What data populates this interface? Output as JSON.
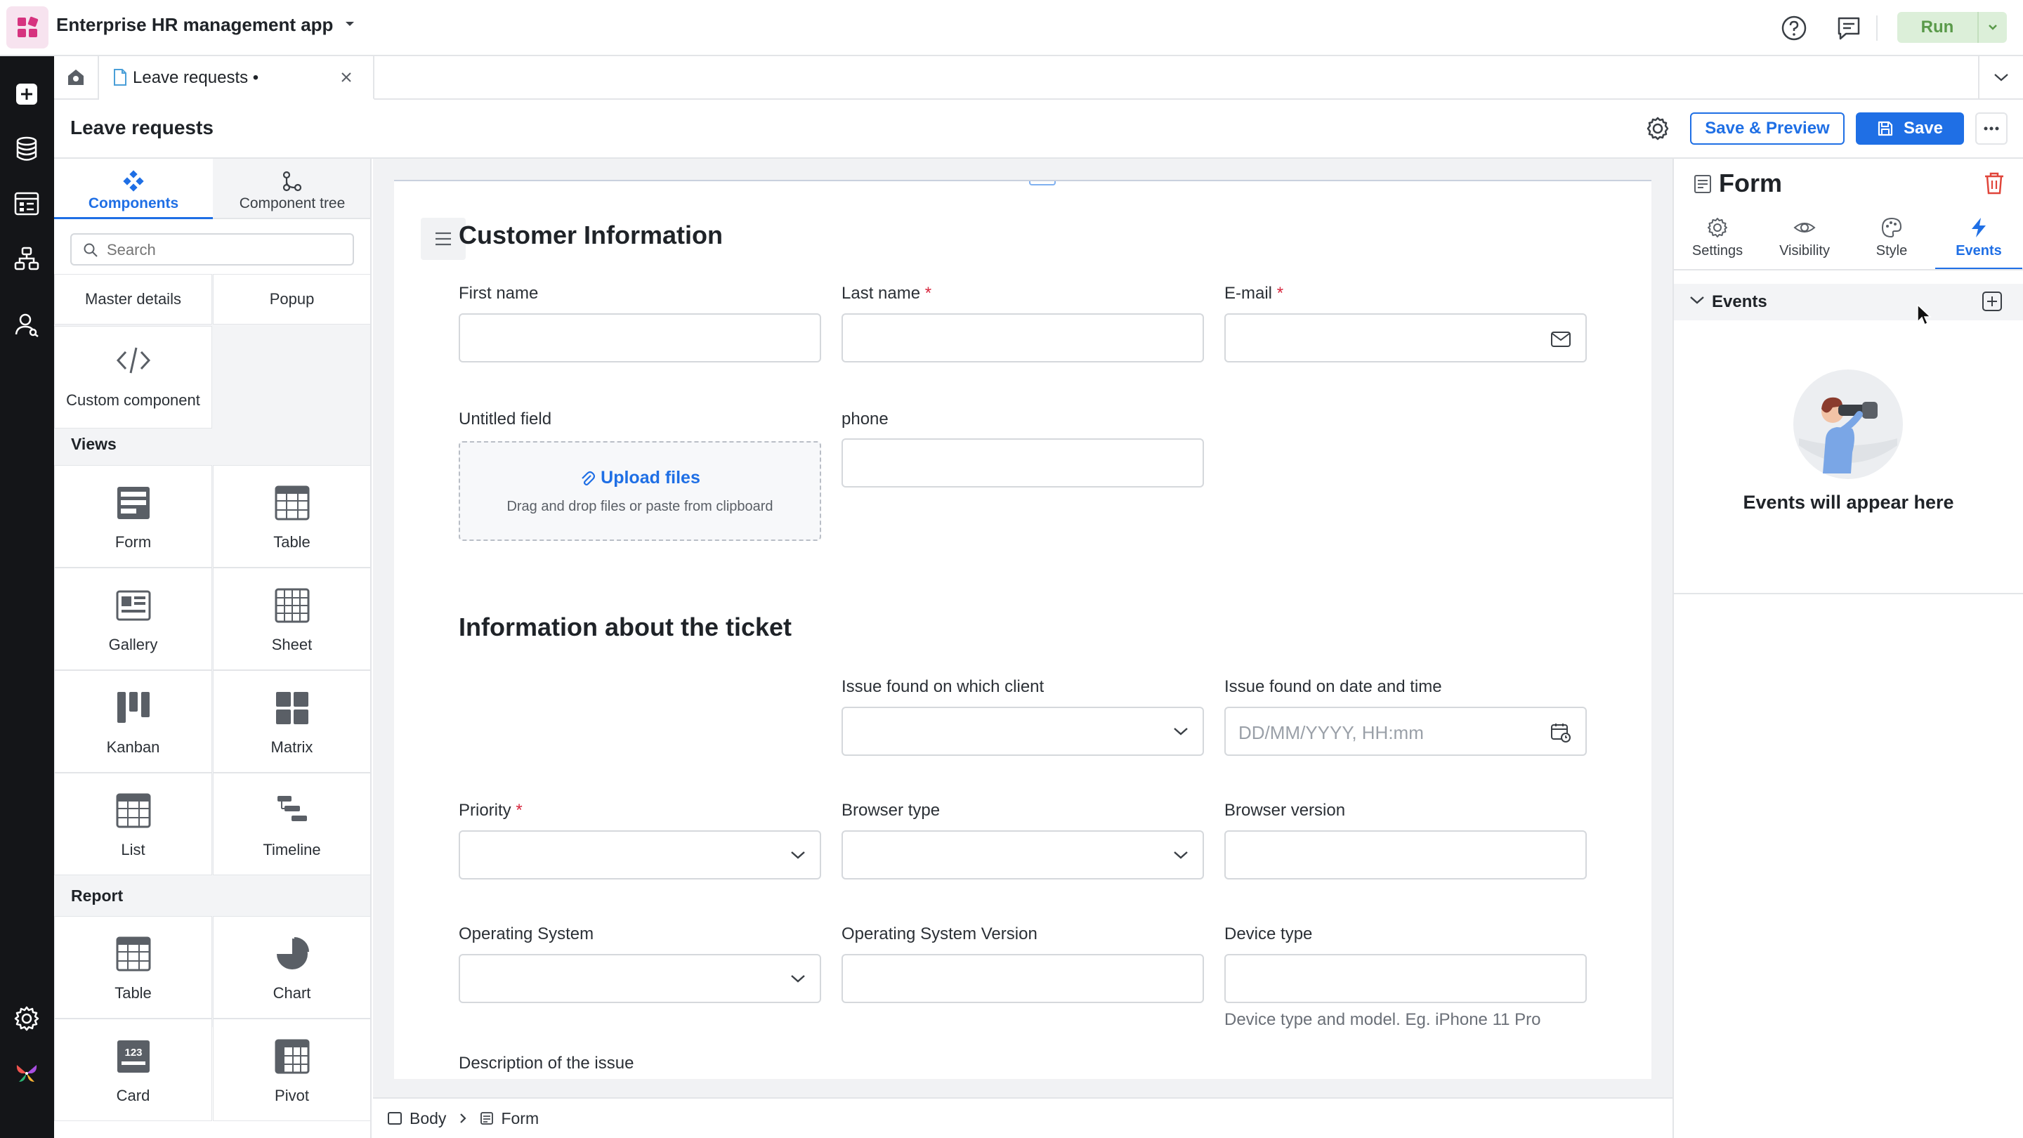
{
  "app": {
    "title": "Enterprise HR management app",
    "run_label": "Run"
  },
  "tabs": {
    "active_tab": "Leave requests •"
  },
  "page": {
    "title": "Leave requests",
    "save_preview_label": "Save & Preview",
    "save_label": "Save"
  },
  "components_panel": {
    "tab_components": "Components",
    "tab_tree": "Component tree",
    "search_placeholder": "Search",
    "top_items": [
      "Master details",
      "Popup"
    ],
    "custom_component": "Custom component",
    "views_title": "Views",
    "views": [
      "Form",
      "Table",
      "Gallery",
      "Sheet",
      "Kanban",
      "Matrix",
      "List",
      "Timeline"
    ],
    "report_title": "Report",
    "report": [
      "Table",
      "Chart",
      "Card",
      "Pivot"
    ]
  },
  "form": {
    "section1_title": "Customer Information",
    "first_name": "First name",
    "last_name": "Last name",
    "email": "E-mail",
    "untitled_field": "Untitled field",
    "phone": "phone",
    "upload_title": "Upload files",
    "upload_hint": "Drag and drop files or paste from clipboard",
    "section2_title": "Information about the ticket",
    "issue_client": "Issue found on which client",
    "issue_date": "Issue found on date and time",
    "issue_date_placeholder": "DD/MM/YYYY, HH:mm",
    "priority": "Priority",
    "browser_type": "Browser type",
    "browser_version": "Browser version",
    "os": "Operating System",
    "os_version": "Operating System Version",
    "device_type": "Device type",
    "device_hint": "Device type and model. Eg. iPhone 11 Pro",
    "description": "Description of the issue"
  },
  "breadcrumb": {
    "body": "Body",
    "form": "Form"
  },
  "properties": {
    "title": "Form",
    "tabs": [
      "Settings",
      "Visibility",
      "Style",
      "Events"
    ],
    "active_tab": "Events",
    "events_header": "Events",
    "empty_text": "Events will appear here"
  },
  "colors": {
    "accent": "#1f6fe5",
    "run_bg": "#dcefd9",
    "required": "#d7263d",
    "rail_bg": "#141518"
  }
}
